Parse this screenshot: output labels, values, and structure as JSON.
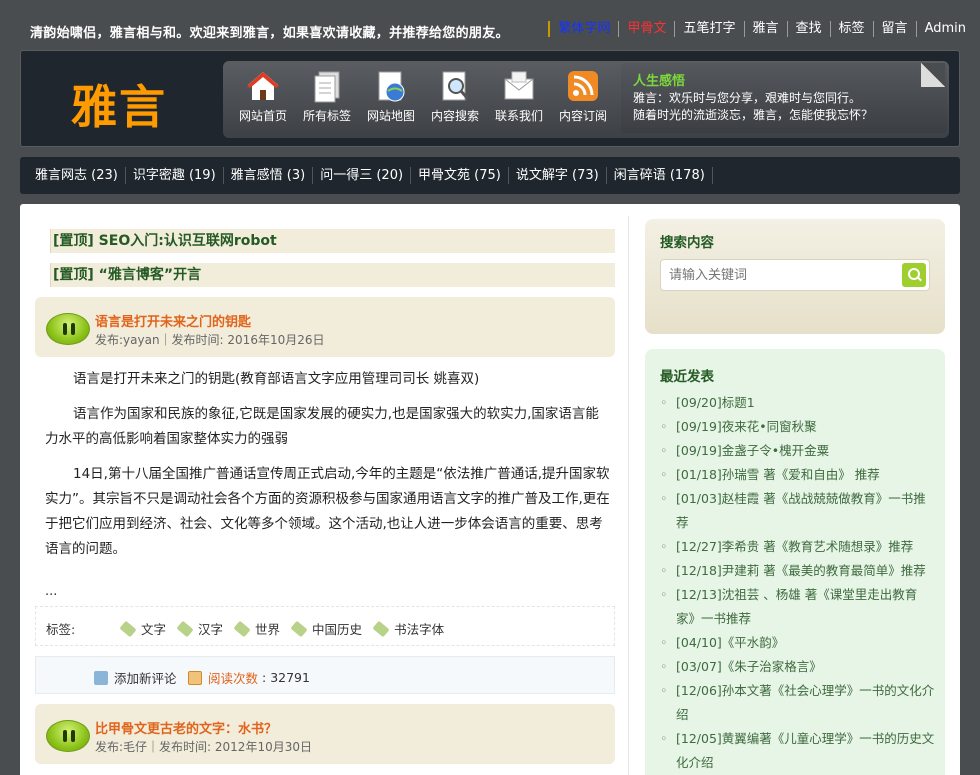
{
  "top": {
    "welcome": "清韵始啸侣，雅言相与和。欢迎来到雅言，如果喜欢请收藏，并推荐给您的朋友。",
    "links": [
      {
        "label": "繁体字网",
        "color": "blue"
      },
      {
        "label": "甲骨文",
        "color": "red"
      },
      {
        "label": "五笔打字",
        "color": "white"
      },
      {
        "label": "雅言",
        "color": "white"
      },
      {
        "label": "查找",
        "color": "white"
      },
      {
        "label": "标签",
        "color": "white"
      },
      {
        "label": "留言",
        "color": "white"
      },
      {
        "label": "Admin",
        "color": "white"
      }
    ]
  },
  "header": {
    "logo": "雅言",
    "nav": [
      "网站首页",
      "所有标签",
      "网站地图",
      "内容搜索",
      "联系我们",
      "内容订阅"
    ],
    "quote_title": "人生感悟",
    "quote_line1": "雅言：欢乐时与您分享，艰难时与您同行。",
    "quote_line2": "随着时光的流逝淡忘，雅言，怎能使我忘怀？"
  },
  "categories": [
    "雅言网志 (23)",
    "识字密趣 (19)",
    "雅言感悟 (3)",
    "问一得三 (20)",
    "甲骨文苑 (75)",
    "说文解字 (73)",
    "闲言碎语 (178)"
  ],
  "sticky": [
    "[置顶] SEO入门:认识互联网robot",
    "[置顶] “雅言博客”开言"
  ],
  "posts": [
    {
      "title": "语言是打开未来之门的钥匙",
      "meta": "发布:yayan｜发布时间: 2016年10月26日",
      "paragraphs": [
        "语言是打开未来之门的钥匙(教育部语言文字应用管理司司长 姚喜双)",
        "语言作为国家和民族的象征,它既是国家发展的硬实力,也是国家强大的软实力,国家语言能力水平的高低影响着国家整体实力的强弱",
        "14日,第十八届全国推广普通话宣传周正式启动,今年的主题是“依法推广普通话,提升国家软实力”。其宗旨不只是调动社会各个方面的资源积极参与国家通用语言文字的推广普及工作,更在于把它们应用到经济、社会、文化等多个领域。这个活动,也让人进一步体会语言的重要、思考语言的问题。"
      ],
      "ellipsis": "...",
      "tags_label": "标签:",
      "tags": [
        "文字",
        "汉字",
        "世界",
        "中国历史",
        "书法字体"
      ],
      "comment": "添加新评论",
      "reads_label": "阅读次数",
      "reads_value": "32791"
    },
    {
      "title": "比甲骨文更古老的文字：水书？",
      "meta": "发布:毛仔｜发布时间: 2012年10月30日"
    }
  ],
  "sidebar": {
    "search_title": "搜索内容",
    "search_placeholder": "请输入关键词",
    "recent_title": "最近发表",
    "recent": [
      "[09/20]标题1",
      "[09/19]夜来花•同窗秋聚",
      "[09/19]金盏子令•槐开金粟",
      "[01/18]孙瑞雪 著《爱和自由》 推荐",
      "[01/03]赵桂霞 著《战战兢兢做教育》一书推荐",
      "[12/27]李希贵 著《教育艺术随想录》推荐",
      "[12/18]尹建莉 著《最美的教育最简单》推荐",
      "[12/13]沈祖芸 、杨雄 著《课堂里走出教育家》一书推荐",
      "[04/10]《平水韵》",
      "[03/07]《朱子治家格言》",
      "[12/06]孙本文著《社会心理学》一书的文化介绍",
      "[12/05]黄翼编著《儿童心理学》一书的历史文化介绍"
    ]
  },
  "colors": {
    "background": "#4a4d50",
    "header_dark": "#1f262e",
    "logo": "#ff9a00",
    "post_title": "#e0641c",
    "green_heading": "#245a24",
    "sticky_bg": "#f2ecda",
    "sidebar_green": "#e6f5e6"
  }
}
